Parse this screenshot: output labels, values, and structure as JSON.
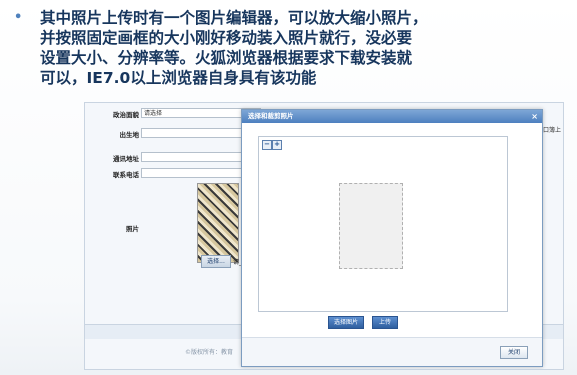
{
  "slide": {
    "bullet": "•",
    "lines": [
      "其中照片上传时有一个图片编辑器，可以放大缩小照片，",
      "并按照固定画框的大小刚好移动装入照片就行，没必要",
      "设置大小、分辨率等。火狐浏览器根据要求下载安装就",
      "可以，IE7.0以上浏览器自身具有该功能"
    ]
  },
  "form": {
    "political_label": "政治面貌",
    "political_value": "请选择",
    "birthplace_label": "出生地",
    "address_label": "通讯地址",
    "phone_label": "联系电话",
    "photo_label": "照片",
    "choose_button": "选择...",
    "after_button": "请_",
    "right_top_text": "...",
    "right_mid_text": "户口簿上的",
    "copyright": "©版权所有：教育"
  },
  "dialog": {
    "title": "选择和裁剪照片",
    "close_symbol": "×",
    "zoom_out": "−",
    "zoom_in": "+",
    "select_image": "选择图片",
    "upload": "上传",
    "close_button": "关闭"
  }
}
